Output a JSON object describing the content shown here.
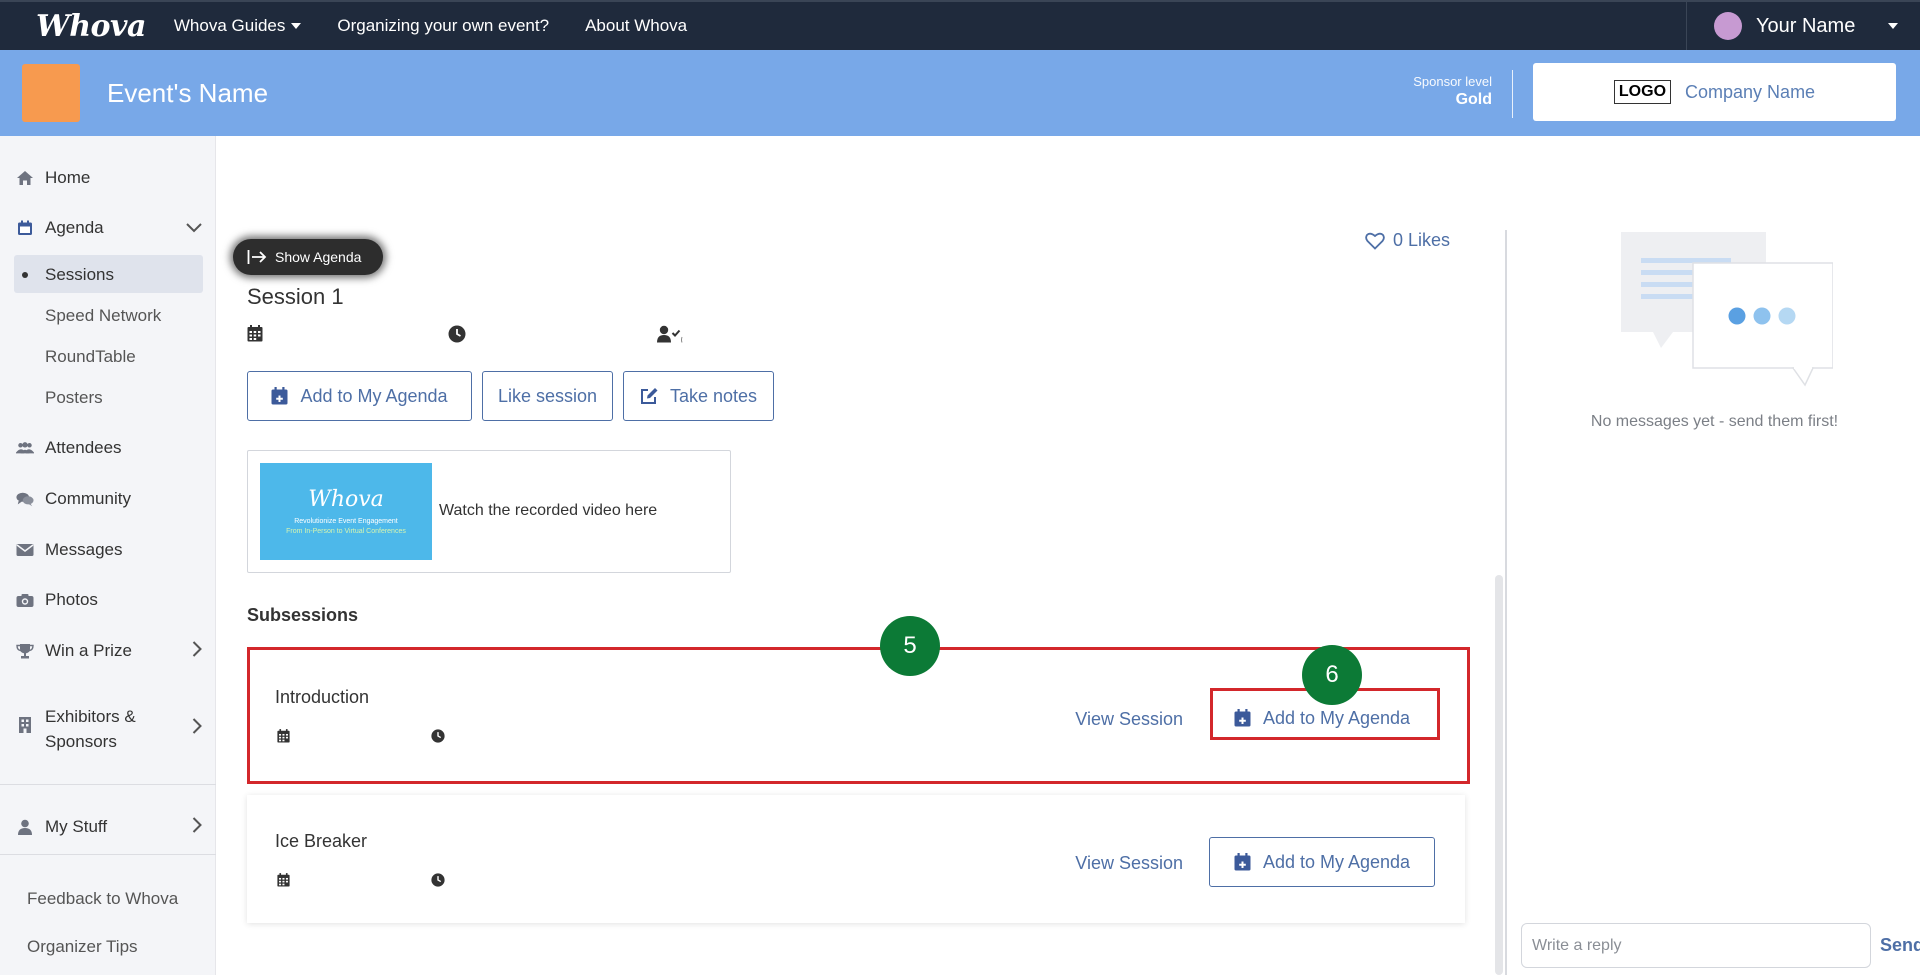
{
  "topnav": {
    "brand": "Whova",
    "links": [
      "Whova Guides",
      "Organizing your own event?",
      "About Whova"
    ],
    "user_name": "Your Name"
  },
  "event": {
    "name": "Event's Name",
    "sponsor_label": "Sponsor level",
    "sponsor_level": "Gold",
    "company_logo": "LOGO",
    "company_name": "Company Name",
    "colors": {
      "header_bg": "#78a8e8",
      "event_logo": "#f79a4f",
      "topnav_bg": "#1f2a3c"
    }
  },
  "sidebar": {
    "items": [
      {
        "label": "Home",
        "icon": "home-icon"
      },
      {
        "label": "Agenda",
        "icon": "calendar-icon"
      },
      {
        "label": "Attendees",
        "icon": "people-icon"
      },
      {
        "label": "Community",
        "icon": "chat-bubbles-icon"
      },
      {
        "label": "Messages",
        "icon": "envelope-icon"
      },
      {
        "label": "Photos",
        "icon": "camera-icon"
      },
      {
        "label": "Win a Prize",
        "icon": "trophy-icon"
      },
      {
        "label": "Exhibitors & Sponsors",
        "icon": "building-icon"
      },
      {
        "label": "My Stuff",
        "icon": "user-icon"
      }
    ],
    "agenda_sub": [
      "Sessions",
      "Speed Network",
      "RoundTable",
      "Posters"
    ],
    "active_sub": "Sessions",
    "footer": [
      "Feedback to Whova",
      "Organizer Tips"
    ]
  },
  "session": {
    "show_agenda": "Show Agenda",
    "likes": "0 Likes",
    "title": "Session 1",
    "buttons": {
      "add_agenda": "Add to My Agenda",
      "like": "Like session",
      "notes": "Take notes"
    },
    "video": {
      "thumb_brand": "Whova",
      "thumb_line1": "Revolutionize Event Engagement",
      "thumb_line2": "From In-Person to Virtual Conferences",
      "text": "Watch the recorded video here"
    },
    "subsessions_heading": "Subsessions",
    "subsessions": [
      {
        "title": "Introduction",
        "view": "View Session",
        "add": "Add to My Agenda"
      },
      {
        "title": "Ice Breaker",
        "view": "View Session",
        "add": "Add to My Agenda"
      }
    ]
  },
  "annotations": {
    "badge_5": "5",
    "badge_6": "6",
    "highlight_color": "#d3272b",
    "badge_color": "#0c7a36"
  },
  "chat": {
    "empty_text": "No messages yet - send them first!",
    "reply_placeholder": "Write a reply",
    "send": "Send"
  }
}
